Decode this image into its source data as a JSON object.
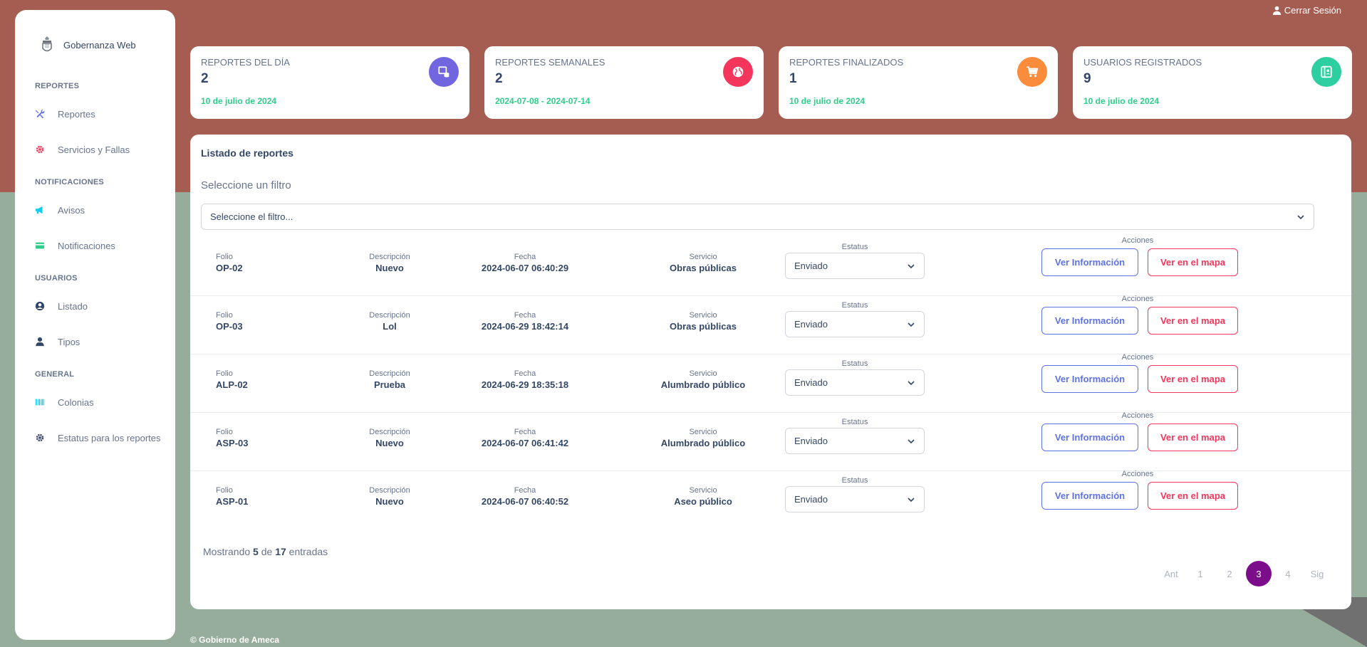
{
  "header": {
    "logout_label": "Cerrar Sesión"
  },
  "sidebar": {
    "brand": "Gobernanza Web",
    "sections": [
      {
        "title": "REPORTES",
        "items": [
          {
            "label": "Reportes",
            "icon": "tools-icon",
            "color": "#5e72e4"
          },
          {
            "label": "Servicios y Fallas",
            "icon": "gear-icon",
            "color": "#f5365c"
          }
        ]
      },
      {
        "title": "NOTIFICACIONES",
        "items": [
          {
            "label": "Avisos",
            "icon": "megaphone-icon",
            "color": "#11cdef"
          },
          {
            "label": "Notificaciones",
            "icon": "credit-card-icon",
            "color": "#2dce89"
          }
        ]
      },
      {
        "title": "USUARIOS",
        "items": [
          {
            "label": "Listado",
            "icon": "user-circle-icon",
            "color": "#344767"
          },
          {
            "label": "Tipos",
            "icon": "user-icon",
            "color": "#344767"
          }
        ]
      },
      {
        "title": "GENERAL",
        "items": [
          {
            "label": "Colonias",
            "icon": "barcode-icon",
            "color": "#11cdef"
          },
          {
            "label": "Estatus para los reportes",
            "icon": "gear-icon",
            "color": "#344767"
          }
        ]
      }
    ]
  },
  "cards": [
    {
      "label": "REPORTES DEL DÍA",
      "value": "2",
      "date": "10 de julio de 2024",
      "icon": "database-icon",
      "color": "#7166e0"
    },
    {
      "label": "REPORTES SEMANALES",
      "value": "2",
      "date": "2024-07-08 - 2024-07-14",
      "icon": "globe-icon",
      "color": "#f5365c"
    },
    {
      "label": "REPORTES FINALIZADOS",
      "value": "1",
      "date": "10 de julio de 2024",
      "icon": "cart-icon",
      "color": "#fb8c3c"
    },
    {
      "label": "USUARIOS REGISTRADOS",
      "value": "9",
      "date": "10 de julio de 2024",
      "icon": "book-icon",
      "color": "#2dce9f"
    }
  ],
  "panel": {
    "title": "Listado de reportes",
    "filter_label": "Seleccione un filtro",
    "filter_placeholder": "Seleccione el filtro..."
  },
  "table": {
    "headers": {
      "folio": "Folio",
      "descripcion": "Descripción",
      "fecha": "Fecha",
      "servicio": "Servicio",
      "estatus": "Estatus",
      "acciones": "Acciones"
    },
    "btn_info": "Ver Información",
    "btn_map": "Ver en el mapa",
    "rows": [
      {
        "folio": "OP-02",
        "descripcion": "Nuevo",
        "fecha": "2024-06-07 06:40:29",
        "servicio": "Obras públicas",
        "estatus": "Enviado"
      },
      {
        "folio": "OP-03",
        "descripcion": "Lol",
        "fecha": "2024-06-29 18:42:14",
        "servicio": "Obras públicas",
        "estatus": "Enviado"
      },
      {
        "folio": "ALP-02",
        "descripcion": "Prueba",
        "fecha": "2024-06-29 18:35:18",
        "servicio": "Alumbrado público",
        "estatus": "Enviado"
      },
      {
        "folio": "ASP-03",
        "descripcion": "Nuevo",
        "fecha": "2024-06-07 06:41:42",
        "servicio": "Alumbrado público",
        "estatus": "Enviado"
      },
      {
        "folio": "ASP-01",
        "descripcion": "Nuevo",
        "fecha": "2024-06-07 06:40:52",
        "servicio": "Aseo público",
        "estatus": "Enviado"
      }
    ]
  },
  "pagination": {
    "showing_prefix": "Mostrando",
    "showing_count": "5",
    "showing_of": "de",
    "showing_total": "17",
    "showing_suffix": "entradas",
    "prev": "Ant",
    "pages": [
      "1",
      "2",
      "3",
      "4"
    ],
    "current": "3",
    "next": "Sig"
  },
  "footer": {
    "text": "© Gobierno de Ameca"
  }
}
